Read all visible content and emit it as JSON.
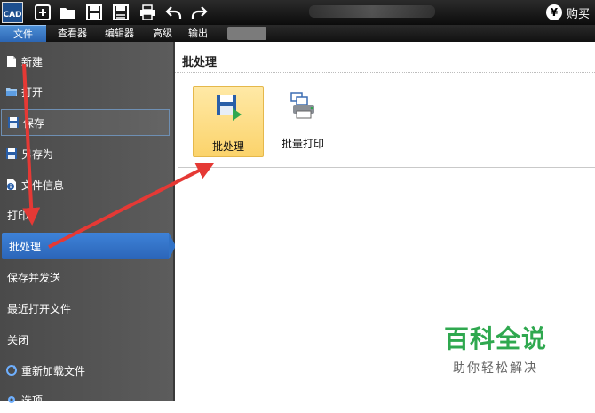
{
  "toolbar": {
    "logo_text": "CAD",
    "buttons": [
      "new-icon",
      "open-icon",
      "save-icon",
      "save-as-icon",
      "print-icon",
      "undo-icon",
      "redo-icon"
    ],
    "buy_label": "购买",
    "buy_symbol": "¥"
  },
  "menubar": {
    "items": [
      "文件",
      "查看器",
      "编辑器",
      "高级",
      "输出"
    ]
  },
  "sidebar": {
    "items": [
      {
        "label": "新建",
        "icon": "new-doc-icon"
      },
      {
        "label": "打开",
        "icon": "open-folder-icon"
      },
      {
        "label": "保存",
        "icon": "floppy-icon"
      },
      {
        "label": "另存为",
        "icon": "save-as-icon"
      },
      {
        "label": "文件信息",
        "icon": "info-icon"
      },
      {
        "label": "打印"
      },
      {
        "label": "批处理"
      },
      {
        "label": "保存并发送"
      },
      {
        "label": "最近打开文件"
      },
      {
        "label": "关闭"
      },
      {
        "label": "重新加载文件",
        "icon": "reload-icon"
      },
      {
        "label": "选项",
        "icon": "options-icon"
      }
    ]
  },
  "main": {
    "title": "批处理",
    "tiles": [
      {
        "label": "批处理",
        "icon": "batch-save-icon"
      },
      {
        "label": "批量打印",
        "icon": "batch-print-icon"
      }
    ]
  },
  "watermark": {
    "main": "百科全说",
    "sub": "助你轻松解决"
  },
  "colors": {
    "accent": "#2f6fc4",
    "arrow": "#e53935",
    "watermark": "#2fa84f"
  }
}
